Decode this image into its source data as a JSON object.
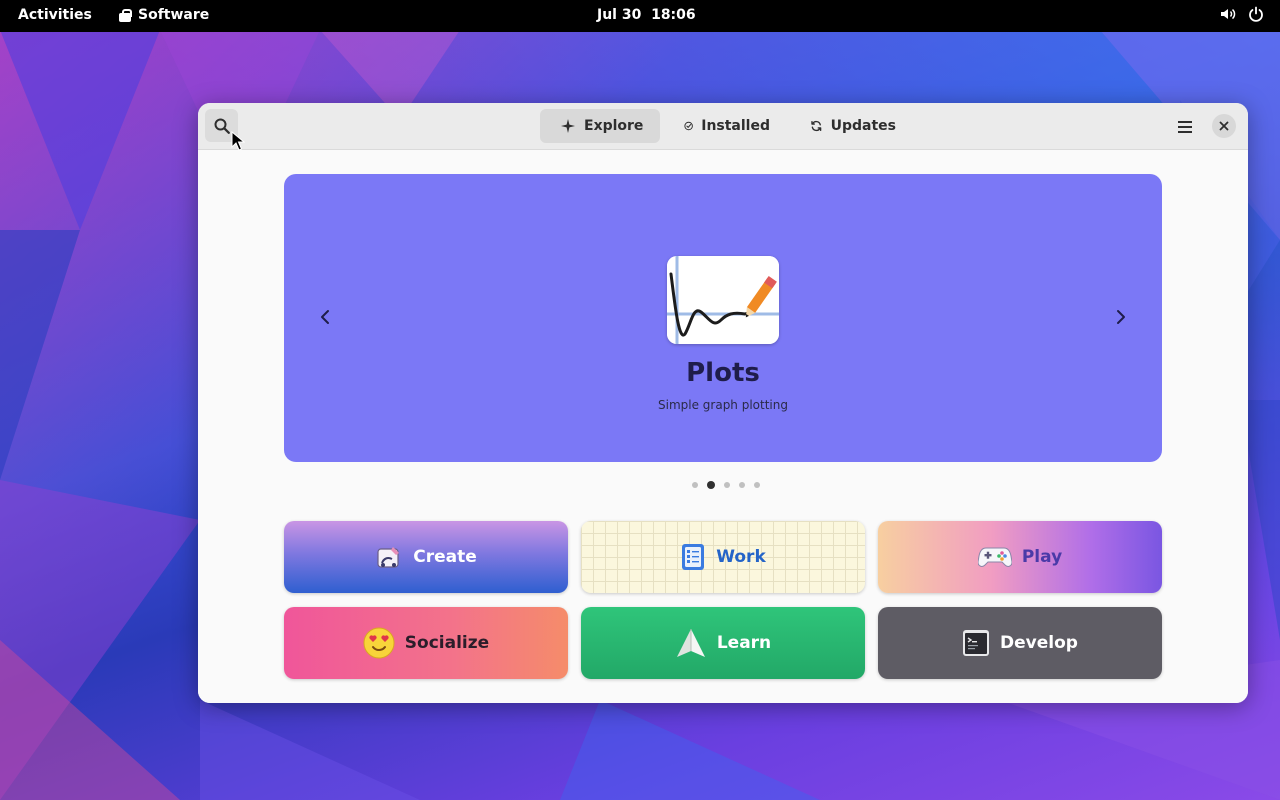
{
  "topbar": {
    "activities": "Activities",
    "app_name": "Software",
    "clock": "Jul 30  18:06"
  },
  "window": {
    "tabs": [
      {
        "label": "Explore",
        "icon": "sparkle-icon",
        "active": true
      },
      {
        "label": "Installed",
        "icon": "check-circle-icon",
        "active": false
      },
      {
        "label": "Updates",
        "icon": "refresh-icon",
        "active": false
      }
    ],
    "featured": {
      "name": "Plots",
      "summary": "Simple graph plotting",
      "background": "#7b78f6",
      "slide_count": 5,
      "active_slide": 2
    },
    "categories": [
      {
        "label": "Create",
        "icon": "create-icon"
      },
      {
        "label": "Work",
        "icon": "work-icon"
      },
      {
        "label": "Play",
        "icon": "gamepad-icon"
      },
      {
        "label": "Socialize",
        "icon": "emoji-heart-eyes-icon"
      },
      {
        "label": "Learn",
        "icon": "paper-plane-icon"
      },
      {
        "label": "Develop",
        "icon": "terminal-icon"
      }
    ]
  }
}
